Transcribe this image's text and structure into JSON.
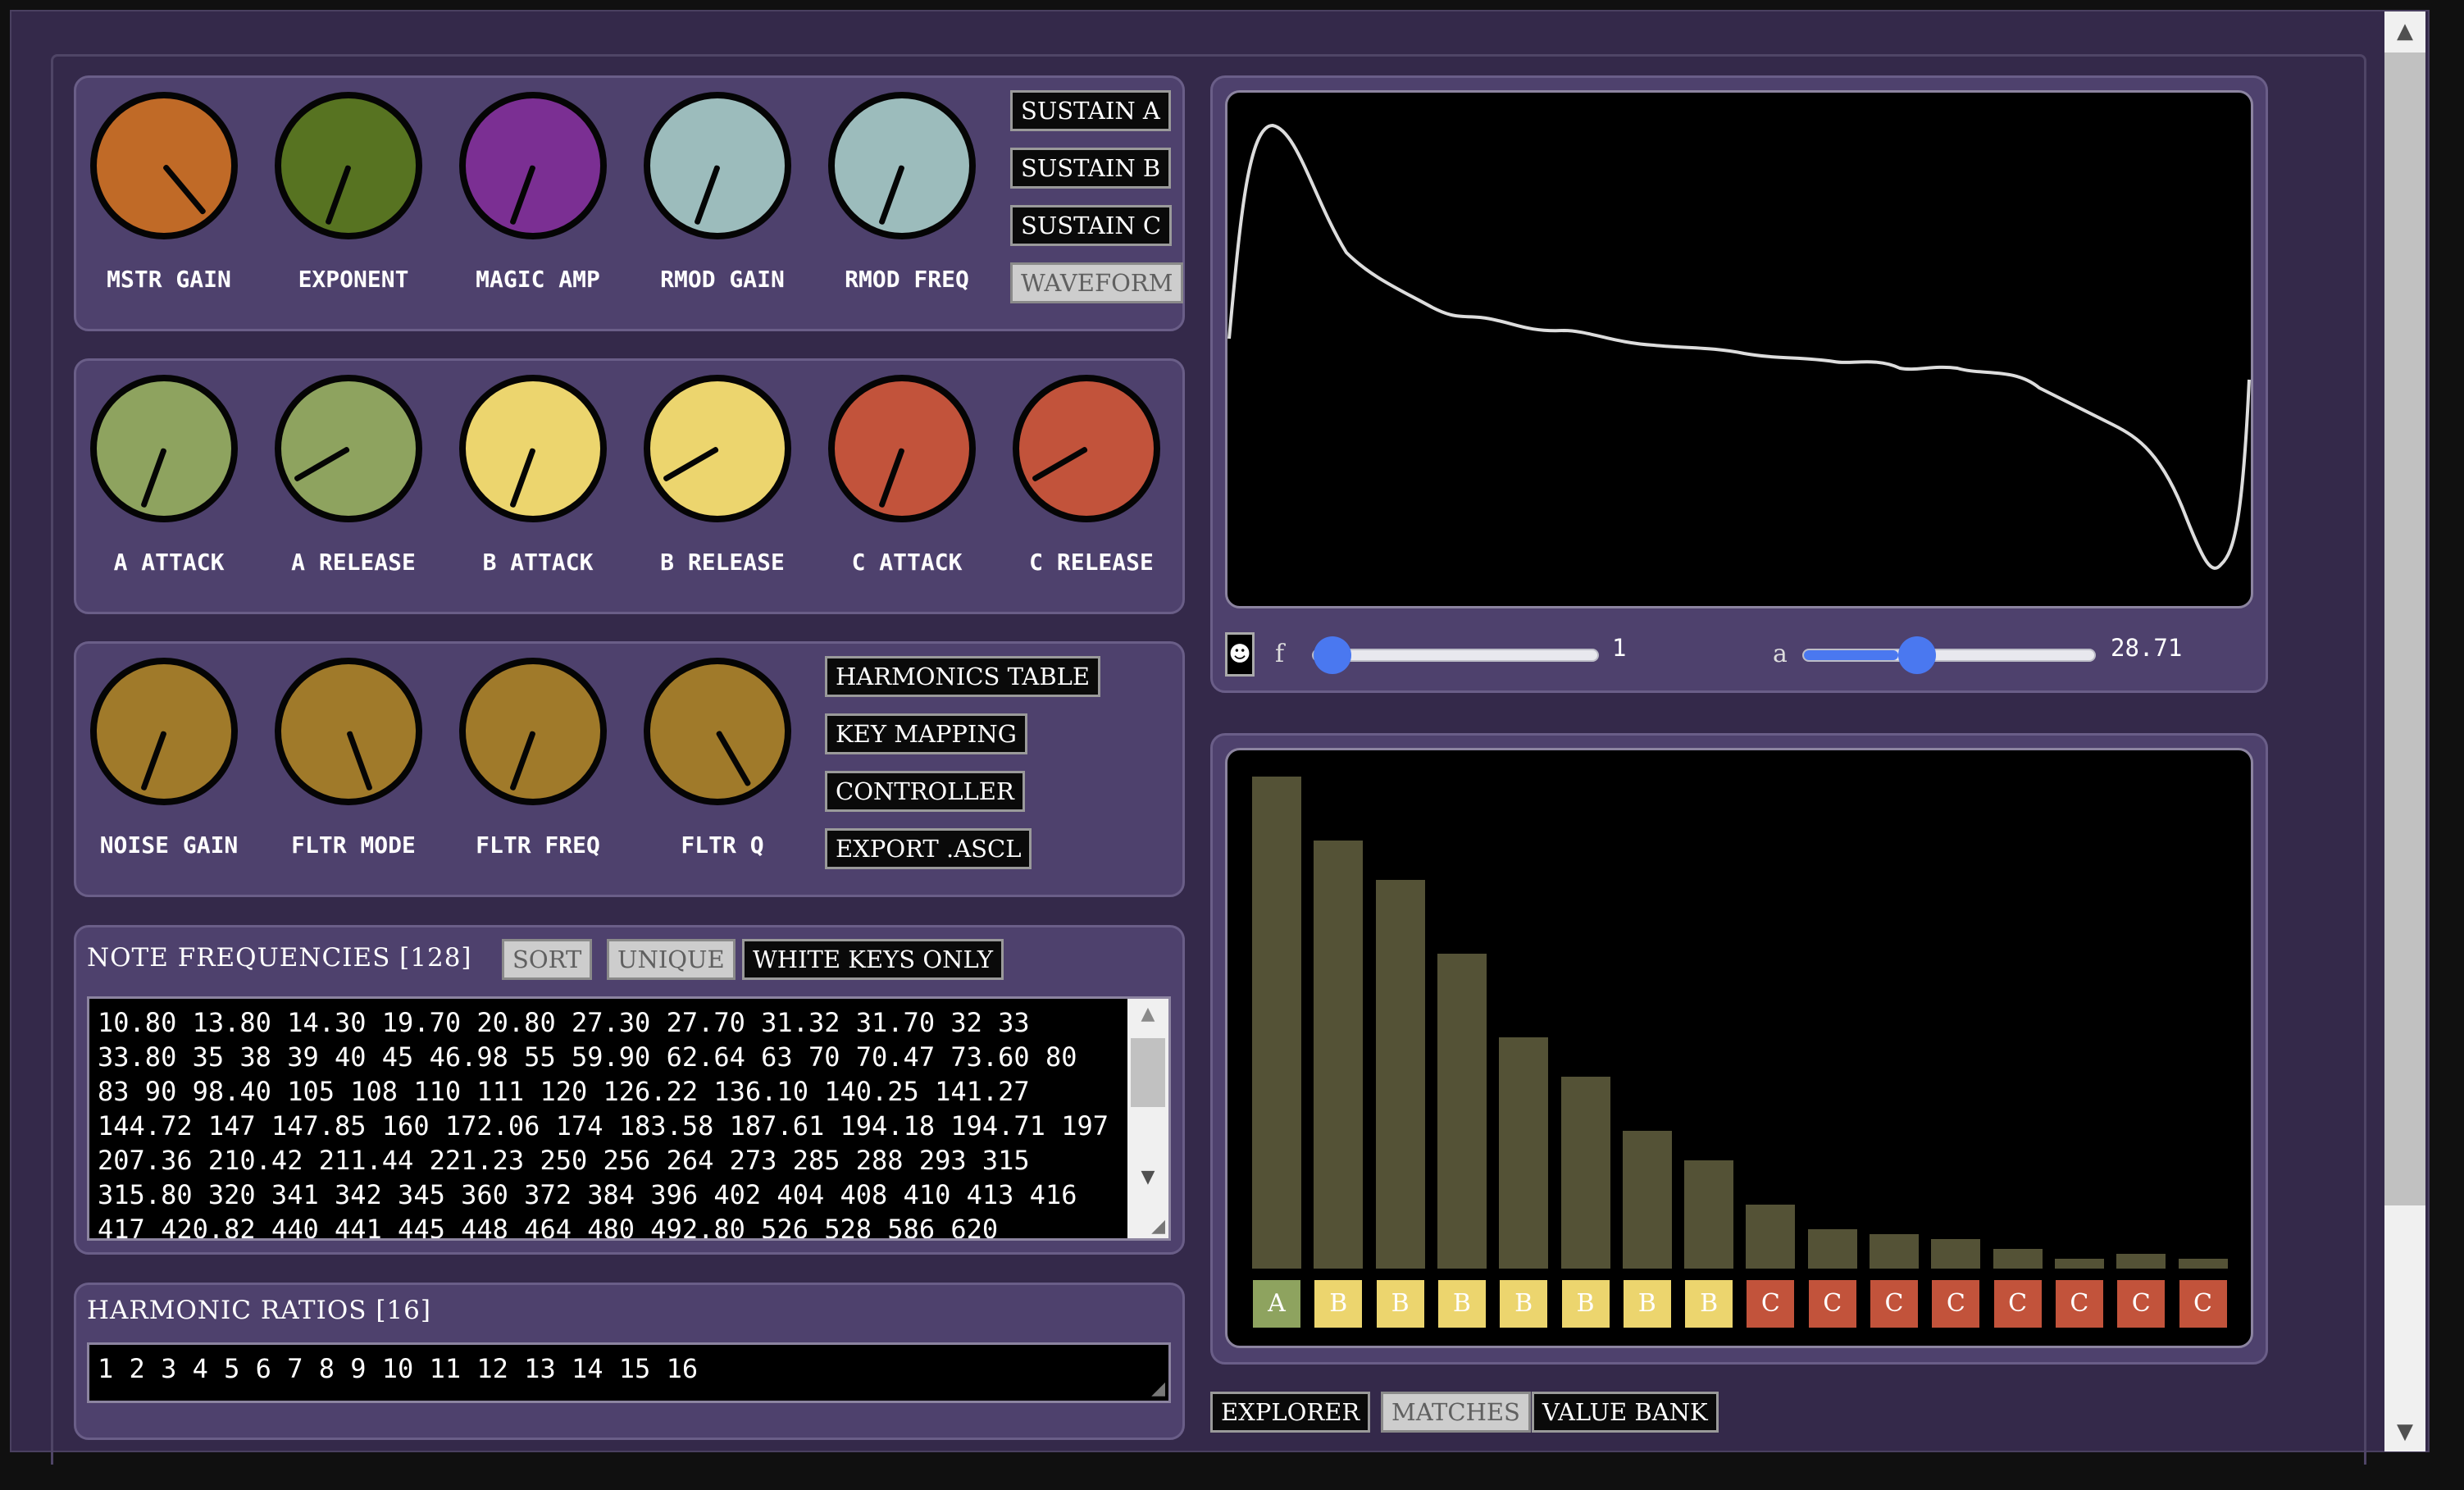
{
  "colors": {
    "bg": "#34294a",
    "panel": "#4e416d",
    "orange": "#c06a27",
    "green_dark": "#577321",
    "purple": "#7b2f93",
    "teal": "#9cbcbc",
    "green_light": "#8ea35f",
    "yellow": "#ecd56e",
    "red": "#c2533b",
    "gold": "#a07a2a",
    "bar": "#545236",
    "slider": "#4a78f0"
  },
  "knobs_row1": {
    "items": [
      {
        "label": "MSTR GAIN",
        "angle": 140,
        "color": "#c06a27"
      },
      {
        "label": "EXPONENT",
        "angle": 200,
        "color": "#577321"
      },
      {
        "label": "MAGIC AMP",
        "angle": 200,
        "color": "#7b2f93"
      },
      {
        "label": "RMOD GAIN",
        "angle": 200,
        "color": "#9cbcbc"
      },
      {
        "label": "RMOD FREQ",
        "angle": 200,
        "color": "#9cbcbc"
      }
    ],
    "buttons": [
      "SUSTAIN A",
      "SUSTAIN B",
      "SUSTAIN C",
      "WAVEFORM"
    ]
  },
  "knobs_row2": {
    "items": [
      {
        "label": "A ATTACK",
        "angle": 200,
        "color": "#8ea35f"
      },
      {
        "label": "A RELEASE",
        "angle": 240,
        "color": "#8ea35f"
      },
      {
        "label": "B ATTACK",
        "angle": 200,
        "color": "#ecd56e"
      },
      {
        "label": "B RELEASE",
        "angle": 240,
        "color": "#ecd56e"
      },
      {
        "label": "C ATTACK",
        "angle": 200,
        "color": "#c2533b"
      },
      {
        "label": "C RELEASE",
        "angle": 240,
        "color": "#c2533b"
      }
    ]
  },
  "knobs_row3": {
    "items": [
      {
        "label": "NOISE GAIN",
        "angle": 200,
        "color": "#a07a2a"
      },
      {
        "label": "FLTR MODE",
        "angle": 160,
        "color": "#a07a2a"
      },
      {
        "label": "FLTR FREQ",
        "angle": 200,
        "color": "#a07a2a"
      },
      {
        "label": "FLTR Q",
        "angle": 150,
        "color": "#a07a2a"
      }
    ],
    "buttons": [
      "HARMONICS TABLE",
      "KEY MAPPING",
      "CONTROLLER",
      "EXPORT .ASCL"
    ]
  },
  "note_frequencies": {
    "title": "NOTE FREQUENCIES [128]",
    "buttons": {
      "sort": "SORT",
      "unique": "UNIQUE",
      "white": "WHITE KEYS ONLY"
    },
    "value": "10.80 13.80 14.30 19.70 20.80 27.30 27.70 31.32 31.70 32 33 33.80 35 38 39 40 45 46.98 55 59.90 62.64 63 70 70.47 73.60 80 83 90 98.40 105 108 110 111 120 126.22 136.10 140.25 141.27 144.72 147 147.85 160 172.06 174 183.58 187.61 194.18 194.71 197 207.36 210.42 211.44 221.23 250 256 264 273 285 288 293 315 315.80 320 341 342 345 360 372 384 396 402 404 408 410 413 416 417 420.82 440 441 445 448 464 480 492.80 526 528 586 620"
  },
  "harmonic_ratios": {
    "title": "HARMONIC RATIOS [16]",
    "value": "1 2 3 4 5 6 7 8 9 10 11 12 13 14 15 16"
  },
  "waveform": {
    "reset_icon": "smiley-icon",
    "f_label": "f",
    "f_value": "1",
    "f_fraction": 0.0,
    "a_label": "a",
    "a_value": "28.71",
    "a_fraction": 0.32
  },
  "chart_data": {
    "type": "bar",
    "categories": [
      "A",
      "B",
      "B",
      "B",
      "B",
      "B",
      "B",
      "B",
      "C",
      "C",
      "C",
      "C",
      "C",
      "C",
      "C",
      "C"
    ],
    "values": [
      1.0,
      0.87,
      0.79,
      0.64,
      0.47,
      0.39,
      0.28,
      0.22,
      0.13,
      0.08,
      0.07,
      0.06,
      0.04,
      0.02,
      0.03,
      0.02
    ],
    "key_colors": {
      "A": "#8ea35f",
      "B": "#ecd56e",
      "C": "#c2533b"
    }
  },
  "bottom_buttons": [
    "EXPLORER",
    "MATCHES",
    "VALUE BANK"
  ]
}
